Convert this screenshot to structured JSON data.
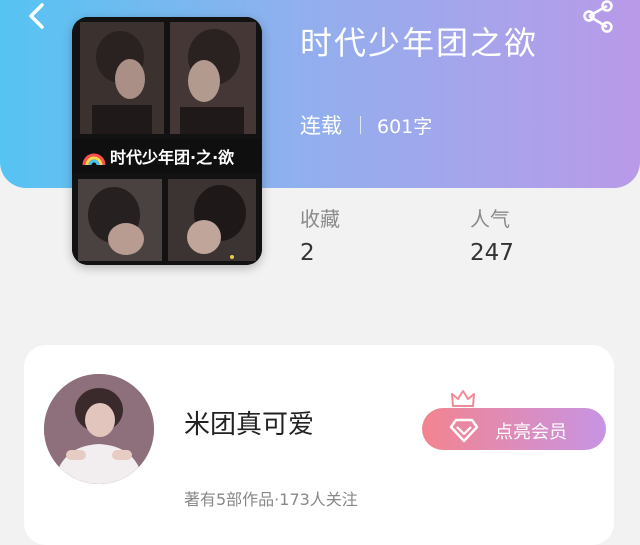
{
  "book": {
    "title": "时代少年团之欲",
    "cover_text": "时代少年团·之·欲",
    "status": "连载",
    "word_count": "601字"
  },
  "stats": {
    "favorites_label": "收藏",
    "favorites_value": "2",
    "popularity_label": "人气",
    "popularity_value": "247"
  },
  "author": {
    "name": "米团真可爱",
    "meta": "著有5部作品·173人关注",
    "member_button_label": "点亮会员"
  },
  "icons": {
    "back": "chevron-left-icon",
    "share": "share-icon",
    "member": "diamond-icon",
    "crown": "crown-icon"
  },
  "colors": {
    "header_gradient_start": "#55c4f2",
    "header_gradient_end": "#b99ae8",
    "member_gradient_start": "#f3848f",
    "member_gradient_end": "#c794e4",
    "crown": "#f08a96"
  }
}
